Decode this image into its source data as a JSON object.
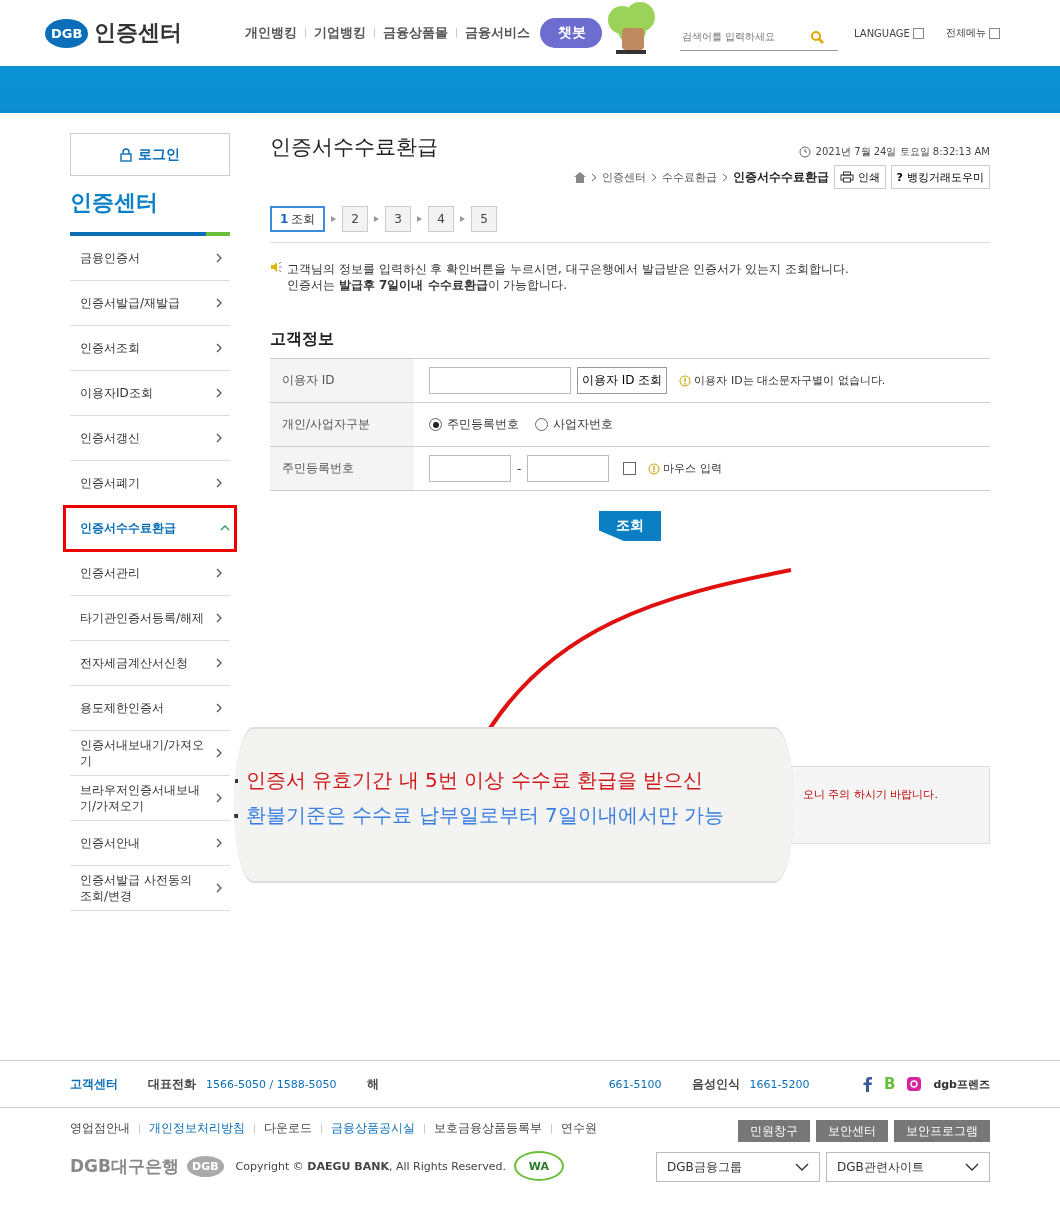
{
  "header": {
    "logo_badge": "DGB",
    "logo_text": "인증센터",
    "nav": [
      "개인뱅킹",
      "기업뱅킹",
      "금융상품몰",
      "금융서비스"
    ],
    "chatbot": "챗봇",
    "search": {
      "placeholder": "검색어를 입력하세요"
    },
    "language": "LANGUAGE",
    "all_menu": "전체메뉴"
  },
  "sidebar": {
    "login": "로그인",
    "title": "인증센터",
    "items": [
      {
        "label": "금융인증서",
        "selected": false
      },
      {
        "label": "인증서발급/재발급",
        "selected": false
      },
      {
        "label": "인증서조회",
        "selected": false
      },
      {
        "label": "이용자ID조회",
        "selected": false
      },
      {
        "label": "인증서갱신",
        "selected": false
      },
      {
        "label": "인증서폐기",
        "selected": false
      },
      {
        "label": "인증서수수료환급",
        "selected": true
      },
      {
        "label": "인증서관리",
        "selected": false
      },
      {
        "label": "타기관인증서등록/해제",
        "selected": false
      },
      {
        "label": "전자세금계산서신청",
        "selected": false
      },
      {
        "label": "용도제한인증서",
        "selected": false
      },
      {
        "label": "인증서내보내기/가져오기",
        "selected": false
      },
      {
        "label": "브라우저인증서내보내기/가져오기",
        "selected": false
      },
      {
        "label": "인증서안내",
        "selected": false
      },
      {
        "label": "인증서발급 사전동의 조회/변경",
        "selected": false
      }
    ]
  },
  "page": {
    "title": "인증서수수료환급",
    "datetime": "2021년 7월 24일 토요일 8:32:13 AM",
    "breadcrumb": [
      "인증센터",
      "수수료환급",
      "인증서수수료환급"
    ],
    "tools": [
      {
        "kind": "print",
        "label": "인쇄"
      },
      {
        "kind": "help",
        "icon": "?",
        "label": "뱅킹거래도우미"
      }
    ],
    "steps": [
      {
        "number": "1",
        "label": "조회",
        "selected": true
      },
      {
        "number": "2",
        "selected": false
      },
      {
        "number": "3",
        "selected": false
      },
      {
        "number": "4",
        "selected": false
      },
      {
        "number": "5",
        "selected": false
      }
    ],
    "intro": [
      "고객님의 정보를 입력하신 후 확인버튼을 누르시면, 대구은행에서 발급받은 인증서가 있는지 조회합니다.",
      "인증서는 **발급후 7일이내 수수료환급**이 가능합니다."
    ],
    "section_title": "고객정보",
    "form": [
      {
        "kind": "id",
        "label": "이용자 ID",
        "button": "이용자 ID 조회",
        "hint": "이용자 ID는 대소문자구별이 없습니다."
      },
      {
        "kind": "radio",
        "label": "개인/사업자구분",
        "options": [
          {
            "label": "주민등록번호",
            "selected": true
          },
          {
            "label": "사업자번호",
            "selected": false
          }
        ]
      },
      {
        "kind": "resident",
        "label": "주민등록번호",
        "separator": "-",
        "checked": false,
        "hint": "마우스 입력"
      }
    ],
    "submit": "조회",
    "notice": "오니 주의 하시기 바랍니다."
  },
  "magnifier": {
    "lines": [
      {
        "kind": "warning",
        "text": "인증서 유효기간 내 5번 이상 수수료 환급을 받으신"
      },
      {
        "kind": "info",
        "text": "환불기준은 수수료 납부일로부터 7일이내에서만 가능"
      }
    ]
  },
  "footer": {
    "contact_title": "고객센터",
    "phones": [
      {
        "label": "대표전화",
        "value": "1566-5050 / 1588-5050"
      },
      {
        "label": "해"
      },
      {
        "value": "661-5100"
      },
      {
        "label": "음성인식",
        "value": "1661-5200"
      }
    ],
    "blog_letter": "B",
    "friends": "dgb프렌즈",
    "links": [
      {
        "label": "영업점안내",
        "highlight": false
      },
      {
        "label": "개인정보처리방침",
        "highlight": true
      },
      {
        "label": "다운로드",
        "highlight": false
      },
      {
        "label": "금융상품공시실",
        "highlight": true
      },
      {
        "label": "보호금융상품등록부",
        "highlight": false
      },
      {
        "label": "연수원",
        "highlight": false
      }
    ],
    "buttons": [
      "민원창구",
      "보안센터",
      "보안프로그램"
    ],
    "bank_logo": "DGB대구은행",
    "bank_badge": "DGB",
    "copyright_prefix": "Copyright © ",
    "copyright_name": "DAEGU BANK",
    "copyright_rest": ", All Rights Reserved.",
    "wa_mark": "WA",
    "selects": [
      "DGB금융그룹",
      "DGB관련사이트"
    ]
  }
}
